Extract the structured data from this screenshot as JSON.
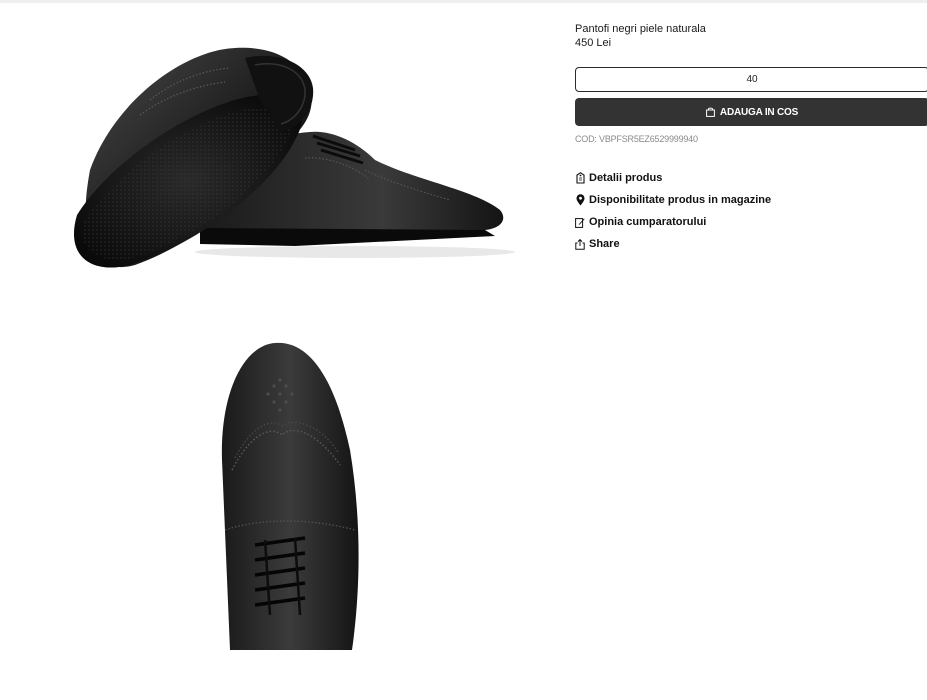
{
  "product": {
    "title": "Pantofi negri piele naturala",
    "price": "450 Lei",
    "size_value": "40",
    "cart_label": "ADAUGA IN COS",
    "cod_label": "COD:",
    "cod_value": "VBPFSR5EZ6529999940"
  },
  "images": {
    "main_alt": "black-leather-brogue-pair",
    "top_alt": "black-leather-brogue-top-view"
  },
  "links": [
    {
      "label": "Detalii produs",
      "icon": "tag-icon"
    },
    {
      "label": "Disponibilitate produs in magazine",
      "icon": "location-pin-icon"
    },
    {
      "label": "Opinia cumparatorului",
      "icon": "edit-icon"
    },
    {
      "label": "Share",
      "icon": "share-icon"
    }
  ],
  "colors": {
    "button_bg": "#333333",
    "button_text": "#ffffff",
    "muted_text": "#8a8a8a"
  }
}
